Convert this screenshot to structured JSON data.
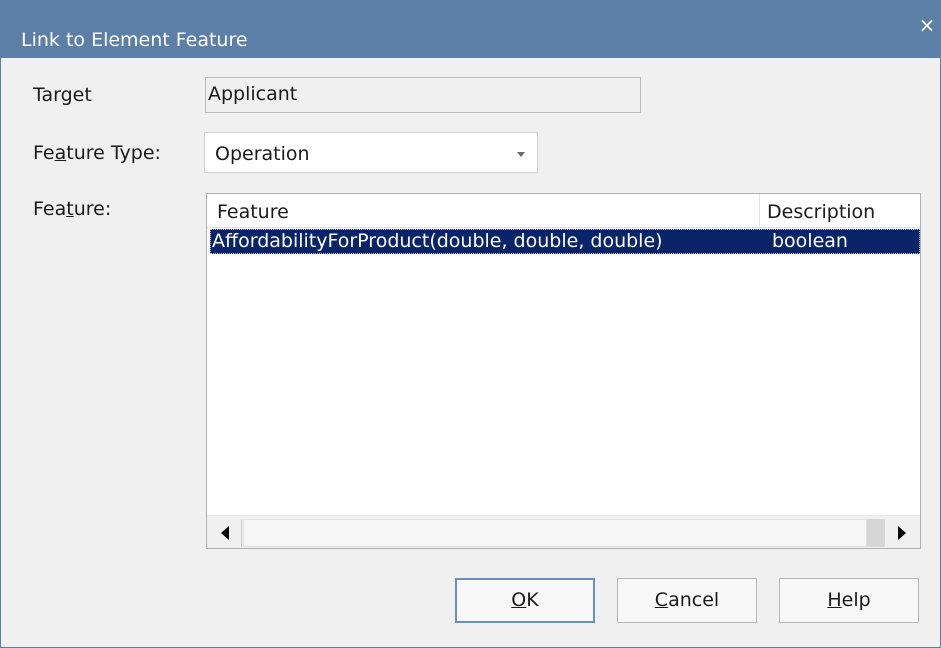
{
  "dialog": {
    "title": "Link to Element Feature",
    "close_symbol": "×"
  },
  "target": {
    "label": "Target",
    "value": "Applicant"
  },
  "feature_type": {
    "label_before": "Fe",
    "label_underlined": "a",
    "label_after": "ture Type:",
    "selected": "Operation"
  },
  "feature": {
    "label_before": "Fea",
    "label_underlined": "t",
    "label_after": "ure:",
    "columns": [
      "Feature",
      "Description"
    ],
    "rows": [
      {
        "feature": "AffordabilityForProduct(double, double, double)",
        "description": "boolean",
        "selected": true
      }
    ]
  },
  "buttons": {
    "ok_underlined": "O",
    "ok_rest": "K",
    "cancel_underlined": "C",
    "cancel_rest": "ancel",
    "help_underlined": "H",
    "help_rest": "elp"
  },
  "colors": {
    "titlebar": "#5c7fa8",
    "selection": "#0a246a"
  }
}
